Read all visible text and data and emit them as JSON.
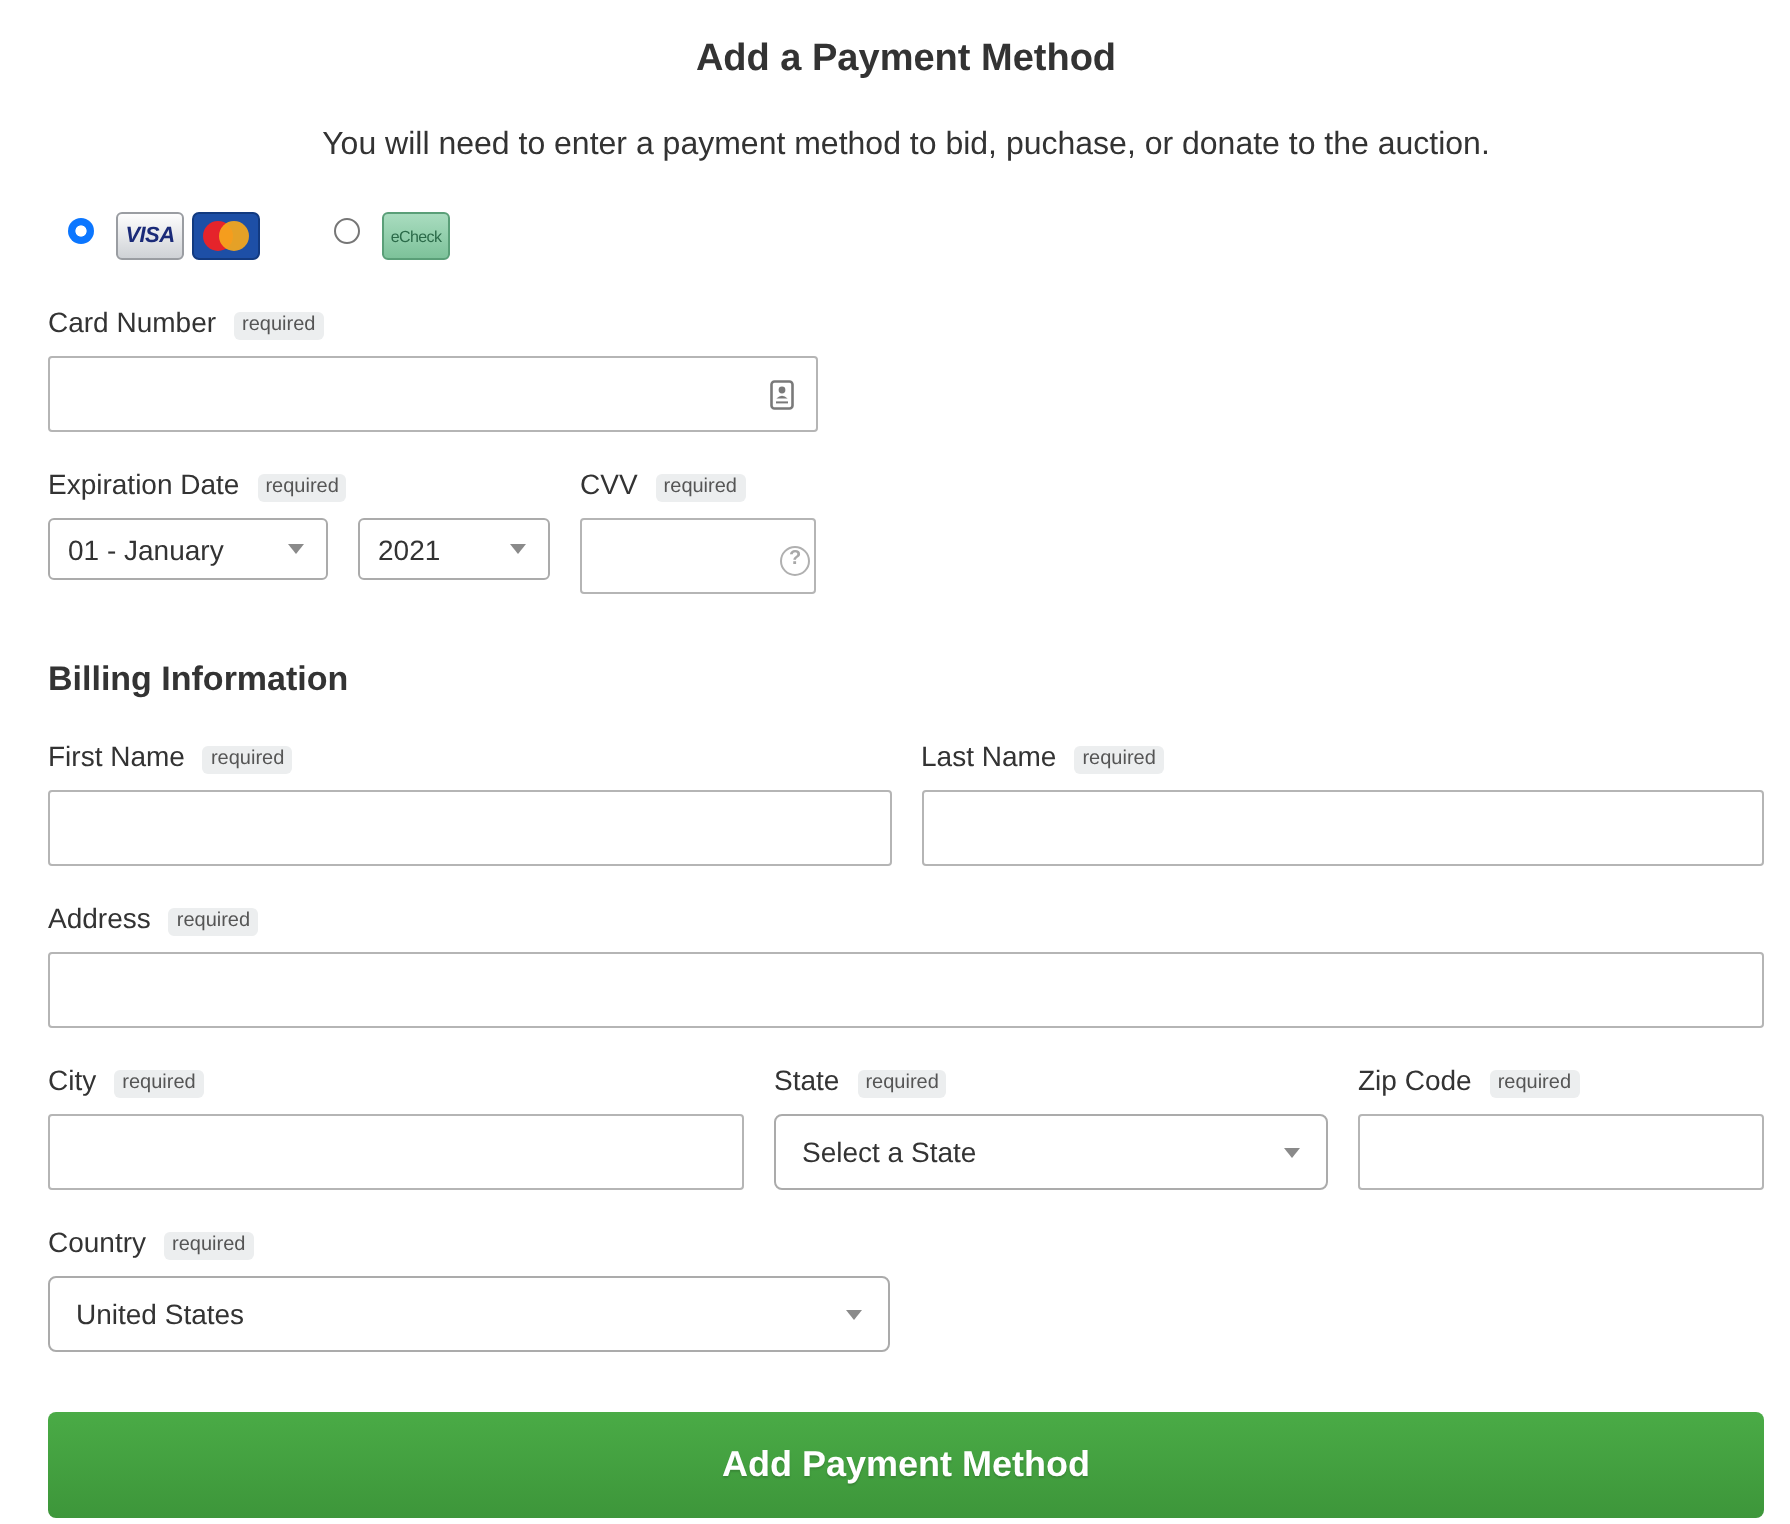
{
  "title": "Add a Payment Method",
  "intro": "You will need to enter a payment method to bid, puchase, or donate to the auction.",
  "payment_types": [
    {
      "selected": true,
      "logos": [
        {
          "kind": "visa",
          "text": "VISA"
        },
        {
          "kind": "mastercard"
        }
      ]
    },
    {
      "selected": false,
      "logos": [
        {
          "kind": "echeck",
          "text": "eCheck"
        }
      ]
    }
  ],
  "card_fields": [
    [
      {
        "label": "Card Number",
        "badge": "required",
        "kind": "card-input"
      }
    ],
    [
      {
        "label": "Expiration Date",
        "badge": "required",
        "kind": "select-pair",
        "selects": [
          {
            "value": "01 - January"
          },
          {
            "value": "2021"
          }
        ]
      },
      {
        "label": "CVV",
        "badge": "required",
        "kind": "cvv-input",
        "help": "?"
      }
    ]
  ],
  "billing": {
    "heading": "Billing Information",
    "rows": [
      [
        {
          "label": "First Name",
          "badge": "required",
          "kind": "input"
        },
        {
          "label": "Last Name",
          "badge": "required",
          "kind": "input"
        }
      ],
      [
        {
          "label": "Address",
          "badge": "required",
          "kind": "input"
        }
      ],
      [
        {
          "label": "City",
          "badge": "required",
          "kind": "input"
        },
        {
          "label": "State",
          "badge": "required",
          "kind": "select",
          "value": "Select a State"
        },
        {
          "label": "Zip Code",
          "badge": "required",
          "kind": "input"
        }
      ],
      [
        {
          "label": "Country",
          "badge": "required",
          "kind": "select",
          "value": "United States"
        }
      ]
    ]
  },
  "submit": {
    "label": "Add Payment Method"
  }
}
